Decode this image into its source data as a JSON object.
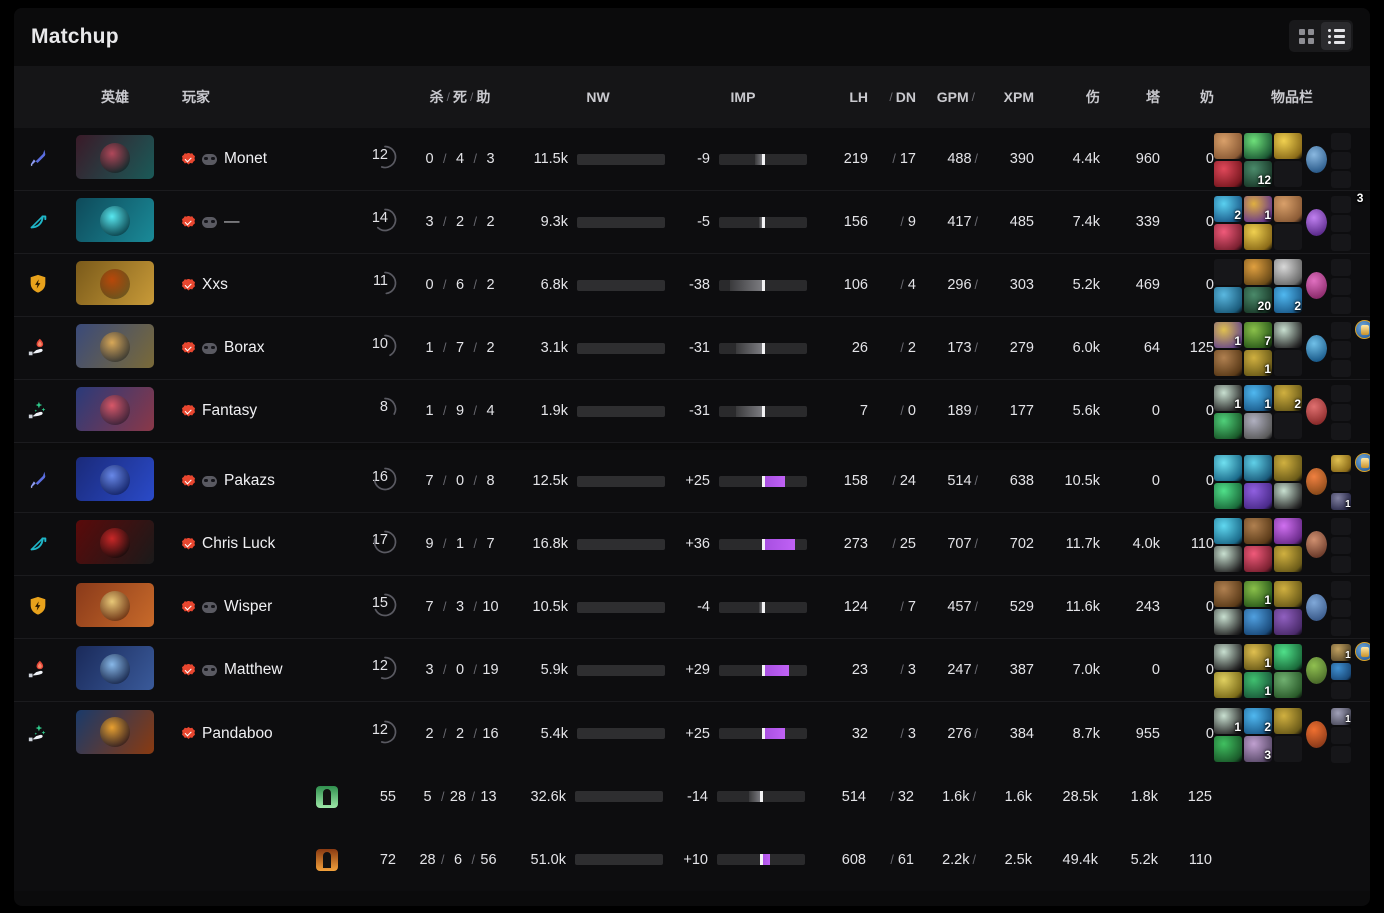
{
  "header": {
    "title": "Matchup",
    "view_grid_label": "grid-view",
    "view_list_label": "list-view",
    "active_view": "list"
  },
  "columns": {
    "hero": "英雄",
    "player": "玩家",
    "kills": "杀",
    "deaths": "死",
    "assists": "助",
    "nw": "NW",
    "imp": "IMP",
    "lh": "LH",
    "dn": "DN",
    "gpm": "GPM",
    "xpm": "XPM",
    "damage": "伤",
    "towers": "塔",
    "healing": "奶",
    "items": "物品栏",
    "slash": "/"
  },
  "colors": {
    "gold": "#e9c04a",
    "purple": "#b95ef0",
    "verified": "#e8462f",
    "radiant": "#5ec07a",
    "dire": "#f2a13c"
  },
  "rows": [
    {
      "role": "carry",
      "verified": true,
      "team_badge": true,
      "player": "Monet",
      "level": "12",
      "level_pct": 55,
      "kills": "0",
      "deaths": "4",
      "assists": "3",
      "nw": "11.5k",
      "nw_pct": 68,
      "imp": "-9",
      "imp_value": -9,
      "lh": "219",
      "dn": "17",
      "gpm": "488",
      "xpm": "390",
      "damage": "4.4k",
      "towers": "960",
      "healing": "0",
      "items": [
        {
          "qty": "",
          "c1": "#8a5a35",
          "c2": "#d9a06a"
        },
        {
          "qty": "",
          "c1": "#1d5a35",
          "c2": "#6ee07a"
        },
        {
          "qty": "",
          "c1": "#8a6a18",
          "c2": "#f0d050"
        },
        {
          "qty": "",
          "c1": "#7a1820",
          "c2": "#e0485a"
        },
        {
          "qty": "12",
          "c1": "#1a3a2a",
          "c2": "#4a8a6a"
        },
        {
          "qty": "",
          "c1": "",
          "c2": ""
        }
      ],
      "neutral": {
        "c1": "#2a5a8a",
        "c2": "#8ab8e0"
      },
      "backpack": [
        {
          "qty": "",
          "c1": "",
          "c2": ""
        },
        {
          "qty": "",
          "c1": "",
          "c2": ""
        },
        {
          "qty": "",
          "c1": "",
          "c2": ""
        }
      ],
      "shard": false,
      "shard_label": ""
    },
    {
      "role": "mid",
      "verified": true,
      "team_badge": true,
      "player": "—",
      "level": "14",
      "level_pct": 62,
      "kills": "3",
      "deaths": "2",
      "assists": "2",
      "nw": "9.3k",
      "nw_pct": 55,
      "imp": "-5",
      "imp_value": -5,
      "lh": "156",
      "dn": "9",
      "gpm": "417",
      "xpm": "485",
      "damage": "7.4k",
      "towers": "339",
      "healing": "0",
      "items": [
        {
          "qty": "2",
          "c1": "#1a5a8a",
          "c2": "#5ad0f0"
        },
        {
          "qty": "1",
          "c1": "#6a3a8a",
          "c2": "#e0b040"
        },
        {
          "qty": "",
          "c1": "#8a5a35",
          "c2": "#d9a06a"
        },
        {
          "qty": "",
          "c1": "#7a2030",
          "c2": "#f05a7a"
        },
        {
          "qty": "",
          "c1": "#8a6a18",
          "c2": "#f0d050"
        },
        {
          "qty": "",
          "c1": "",
          "c2": ""
        }
      ],
      "neutral": {
        "c1": "#5a2a8a",
        "c2": "#c080f0"
      },
      "backpack": [
        {
          "qty": "",
          "c1": "",
          "c2": ""
        },
        {
          "qty": "",
          "c1": "",
          "c2": ""
        },
        {
          "qty": "",
          "c1": "",
          "c2": ""
        }
      ],
      "shard": false,
      "shard_label": "3"
    },
    {
      "role": "offlane",
      "verified": true,
      "team_badge": false,
      "player": "Xxs",
      "level": "11",
      "level_pct": 48,
      "kills": "0",
      "deaths": "6",
      "assists": "2",
      "nw": "6.8k",
      "nw_pct": 40,
      "imp": "-38",
      "imp_value": -38,
      "lh": "106",
      "dn": "4",
      "gpm": "296",
      "xpm": "303",
      "damage": "5.2k",
      "towers": "469",
      "healing": "0",
      "items": [
        {
          "qty": "",
          "c1": "",
          "c2": ""
        },
        {
          "qty": "",
          "c1": "#6a4a18",
          "c2": "#e0a040"
        },
        {
          "qty": "",
          "c1": "#6a6a6a",
          "c2": "#d8d8d8"
        },
        {
          "qty": "",
          "c1": "#1a5a7a",
          "c2": "#5ab8e0"
        },
        {
          "qty": "20",
          "c1": "#1a3a2a",
          "c2": "#4a8a6a"
        },
        {
          "qty": "2",
          "c1": "#1a5a8a",
          "c2": "#50b8f0"
        }
      ],
      "neutral": {
        "c1": "#8a2a6a",
        "c2": "#e070c0"
      },
      "backpack": [
        {
          "qty": "",
          "c1": "",
          "c2": ""
        },
        {
          "qty": "",
          "c1": "",
          "c2": ""
        },
        {
          "qty": "",
          "c1": "",
          "c2": ""
        }
      ],
      "shard": false,
      "shard_label": ""
    },
    {
      "role": "soft-support",
      "verified": true,
      "team_badge": true,
      "player": "Borax",
      "level": "10",
      "level_pct": 42,
      "kills": "1",
      "deaths": "7",
      "assists": "2",
      "nw": "3.1k",
      "nw_pct": 18,
      "imp": "-31",
      "imp_value": -31,
      "lh": "26",
      "dn": "2",
      "gpm": "173",
      "xpm": "279",
      "damage": "6.0k",
      "towers": "64",
      "healing": "125",
      "items": [
        {
          "qty": "1",
          "c1": "#6a4a8a",
          "c2": "#e0c050"
        },
        {
          "qty": "7",
          "c1": "#2a5a1a",
          "c2": "#8ac04a"
        },
        {
          "qty": "",
          "c1": "#2a2a2a",
          "c2": "#c8e0d0"
        },
        {
          "qty": "",
          "c1": "#5a3a18",
          "c2": "#b08050"
        },
        {
          "qty": "1",
          "c1": "#6a5a18",
          "c2": "#d0b040"
        },
        {
          "qty": "",
          "c1": "",
          "c2": ""
        }
      ],
      "neutral": {
        "c1": "#1a5a8a",
        "c2": "#70c0e8"
      },
      "backpack": [
        {
          "qty": "",
          "c1": "",
          "c2": ""
        },
        {
          "qty": "",
          "c1": "",
          "c2": ""
        },
        {
          "qty": "",
          "c1": "",
          "c2": ""
        }
      ],
      "shard": true,
      "shard_label": ""
    },
    {
      "role": "hard-support",
      "verified": true,
      "team_badge": false,
      "player": "Fantasy",
      "level": "8",
      "level_pct": 33,
      "kills": "1",
      "deaths": "9",
      "assists": "4",
      "nw": "1.9k",
      "nw_pct": 11,
      "imp": "-31",
      "imp_value": -31,
      "lh": "7",
      "dn": "0",
      "gpm": "189",
      "xpm": "177",
      "damage": "5.6k",
      "towers": "0",
      "healing": "0",
      "items": [
        {
          "qty": "1",
          "c1": "#2a2a2a",
          "c2": "#c8e0d0"
        },
        {
          "qty": "1",
          "c1": "#1a5a8a",
          "c2": "#50b8f0"
        },
        {
          "qty": "2",
          "c1": "#6a5a18",
          "c2": "#d0b040"
        },
        {
          "qty": "",
          "c1": "#1a5a2a",
          "c2": "#50d07a"
        },
        {
          "qty": "",
          "c1": "#5a5a5a",
          "c2": "#b0b0c0"
        },
        {
          "qty": "",
          "c1": "",
          "c2": ""
        }
      ],
      "neutral": {
        "c1": "#8a2a2a",
        "c2": "#e07070"
      },
      "backpack": [
        {
          "qty": "",
          "c1": "",
          "c2": ""
        },
        {
          "qty": "",
          "c1": "",
          "c2": ""
        },
        {
          "qty": "",
          "c1": "",
          "c2": ""
        }
      ],
      "shard": false,
      "shard_label": ""
    },
    {
      "role": "carry",
      "verified": true,
      "team_badge": true,
      "player": "Pakazs",
      "level": "16",
      "level_pct": 72,
      "kills": "7",
      "deaths": "0",
      "assists": "8",
      "nw": "12.5k",
      "nw_pct": 74,
      "imp": "+25",
      "imp_value": 25,
      "lh": "158",
      "dn": "24",
      "gpm": "514",
      "xpm": "638",
      "damage": "10.5k",
      "towers": "0",
      "healing": "0",
      "items": [
        {
          "qty": "",
          "c1": "#1a6a8a",
          "c2": "#70e0f0"
        },
        {
          "qty": "",
          "c1": "#1a5a7a",
          "c2": "#60d0e8"
        },
        {
          "qty": "",
          "c1": "#6a5a18",
          "c2": "#d0b040"
        },
        {
          "qty": "",
          "c1": "#1a6a3a",
          "c2": "#50e08a"
        },
        {
          "qty": "",
          "c1": "#4a2a8a",
          "c2": "#9060e0"
        },
        {
          "qty": "",
          "c1": "#2a2a2a",
          "c2": "#c8e0d0"
        }
      ],
      "neutral": {
        "c1": "#8a4a1a",
        "c2": "#f08040"
      },
      "backpack": [
        {
          "qty": "",
          "c1": "#8a6a18",
          "c2": "#e0c050"
        },
        {
          "qty": "",
          "c1": "",
          "c2": ""
        },
        {
          "qty": "1",
          "c1": "#2a2a4a",
          "c2": "#8080a0"
        }
      ],
      "shard": true,
      "shard_label": ""
    },
    {
      "role": "mid",
      "verified": true,
      "team_badge": false,
      "player": "Chris Luck",
      "level": "17",
      "level_pct": 80,
      "kills": "9",
      "deaths": "1",
      "assists": "7",
      "nw": "16.8k",
      "nw_pct": 100,
      "imp": "+36",
      "imp_value": 36,
      "lh": "273",
      "dn": "25",
      "gpm": "707",
      "xpm": "702",
      "damage": "11.7k",
      "towers": "4.0k",
      "healing": "110",
      "items": [
        {
          "qty": "",
          "c1": "#1a6a8a",
          "c2": "#60d8f0"
        },
        {
          "qty": "",
          "c1": "#5a3a18",
          "c2": "#b08050"
        },
        {
          "qty": "",
          "c1": "#6a2a8a",
          "c2": "#d070f0"
        },
        {
          "qty": "",
          "c1": "#2a2a2a",
          "c2": "#c8e0d0"
        },
        {
          "qty": "",
          "c1": "#7a2030",
          "c2": "#f05a7a"
        },
        {
          "qty": "",
          "c1": "#6a5a18",
          "c2": "#d0b040"
        }
      ],
      "neutral": {
        "c1": "#6a3a2a",
        "c2": "#d09070"
      },
      "backpack": [
        {
          "qty": "",
          "c1": "",
          "c2": ""
        },
        {
          "qty": "",
          "c1": "",
          "c2": ""
        },
        {
          "qty": "",
          "c1": "",
          "c2": ""
        }
      ],
      "shard": false,
      "shard_label": ""
    },
    {
      "role": "offlane",
      "verified": true,
      "team_badge": true,
      "player": "Wisper",
      "level": "15",
      "level_pct": 68,
      "kills": "7",
      "deaths": "3",
      "assists": "10",
      "nw": "10.5k",
      "nw_pct": 62,
      "imp": "-4",
      "imp_value": -4,
      "lh": "124",
      "dn": "7",
      "gpm": "457",
      "xpm": "529",
      "damage": "11.6k",
      "towers": "243",
      "healing": "0",
      "items": [
        {
          "qty": "",
          "c1": "#5a3a18",
          "c2": "#b08050"
        },
        {
          "qty": "1",
          "c1": "#2a5a1a",
          "c2": "#8ac04a"
        },
        {
          "qty": "",
          "c1": "#6a5a18",
          "c2": "#d0b040"
        },
        {
          "qty": "",
          "c1": "#2a2a2a",
          "c2": "#c8e0d0"
        },
        {
          "qty": "",
          "c1": "#1a4a7a",
          "c2": "#50a0e0"
        },
        {
          "qty": "",
          "c1": "#4a2a6a",
          "c2": "#9060c0"
        }
      ],
      "neutral": {
        "c1": "#3a5a8a",
        "c2": "#80a8d8"
      },
      "backpack": [
        {
          "qty": "",
          "c1": "",
          "c2": ""
        },
        {
          "qty": "",
          "c1": "",
          "c2": ""
        },
        {
          "qty": "",
          "c1": "",
          "c2": ""
        }
      ],
      "shard": false,
      "shard_label": ""
    },
    {
      "role": "soft-support",
      "verified": true,
      "team_badge": true,
      "player": "Matthew",
      "level": "12",
      "level_pct": 55,
      "kills": "3",
      "deaths": "0",
      "assists": "19",
      "nw": "5.9k",
      "nw_pct": 35,
      "imp": "+29",
      "imp_value": 29,
      "lh": "23",
      "dn": "3",
      "gpm": "247",
      "xpm": "387",
      "damage": "7.0k",
      "towers": "0",
      "healing": "0",
      "items": [
        {
          "qty": "",
          "c1": "#2a2a2a",
          "c2": "#c8e0d0"
        },
        {
          "qty": "1",
          "c1": "#6a5a18",
          "c2": "#e0c050"
        },
        {
          "qty": "",
          "c1": "#1a6a3a",
          "c2": "#50e08a"
        },
        {
          "qty": "",
          "c1": "#7a6a18",
          "c2": "#e0d060"
        },
        {
          "qty": "1",
          "c1": "#1a5a3a",
          "c2": "#40c070"
        },
        {
          "qty": "",
          "c1": "#2a5a2a",
          "c2": "#70b070"
        }
      ],
      "neutral": {
        "c1": "#4a6a2a",
        "c2": "#90c050"
      },
      "backpack": [
        {
          "qty": "1",
          "c1": "#5a4a2a",
          "c2": "#c0a060"
        },
        {
          "qty": "",
          "c1": "#1a4a7a",
          "c2": "#4090d0"
        },
        {
          "qty": "",
          "c1": "",
          "c2": ""
        }
      ],
      "shard": true,
      "shard_label": ""
    },
    {
      "role": "hard-support",
      "verified": true,
      "team_badge": false,
      "player": "Pandaboo",
      "level": "12",
      "level_pct": 55,
      "kills": "2",
      "deaths": "2",
      "assists": "16",
      "nw": "5.4k",
      "nw_pct": 32,
      "imp": "+25",
      "imp_value": 25,
      "lh": "32",
      "dn": "3",
      "gpm": "276",
      "xpm": "384",
      "damage": "8.7k",
      "towers": "955",
      "healing": "0",
      "items": [
        {
          "qty": "1",
          "c1": "#2a2a2a",
          "c2": "#c8e0d0"
        },
        {
          "qty": "2",
          "c1": "#1a5a8a",
          "c2": "#50b8f0"
        },
        {
          "qty": "",
          "c1": "#6a5a18",
          "c2": "#d0b040"
        },
        {
          "qty": "",
          "c1": "#1a5a2a",
          "c2": "#40c060"
        },
        {
          "qty": "3",
          "c1": "#5a4a6a",
          "c2": "#c0a0d0"
        },
        {
          "qty": "",
          "c1": "",
          "c2": ""
        }
      ],
      "neutral": {
        "c1": "#8a3a1a",
        "c2": "#f07030"
      },
      "backpack": [
        {
          "qty": "1",
          "c1": "#4a4a5a",
          "c2": "#a0a0b8"
        },
        {
          "qty": "",
          "c1": "",
          "c2": ""
        },
        {
          "qty": "",
          "c1": "",
          "c2": ""
        }
      ],
      "shard": false,
      "shard_label": ""
    }
  ],
  "summary": [
    {
      "team": "radiant",
      "level": "55",
      "kills": "5",
      "deaths": "28",
      "assists": "13",
      "nw": "32.6k",
      "nw_pct": 64,
      "imp": "-14",
      "imp_value": -14,
      "lh": "514",
      "dn": "32",
      "gpm": "1.6k",
      "xpm": "1.6k",
      "damage": "28.5k",
      "towers": "1.8k",
      "healing": "125"
    },
    {
      "team": "dire",
      "level": "72",
      "kills": "28",
      "deaths": "6",
      "assists": "56",
      "nw": "51.0k",
      "nw_pct": 100,
      "imp": "+10",
      "imp_value": 10,
      "lh": "608",
      "dn": "61",
      "gpm": "2.2k",
      "xpm": "2.5k",
      "damage": "49.4k",
      "towers": "5.2k",
      "healing": "110"
    }
  ],
  "hero_art": [
    {
      "bg1": "#3a1a28",
      "bg2": "#1a5a58",
      "face": "#b0485a"
    },
    {
      "bg1": "#0e4a5a",
      "bg2": "#1a8a98",
      "face": "#58e8f0"
    },
    {
      "bg1": "#7a5a1a",
      "bg2": "#c89a38",
      "face": "#b8480a"
    },
    {
      "bg1": "#3a4a7a",
      "bg2": "#7a6a38",
      "face": "#d8a858"
    },
    {
      "bg1": "#2a3a7a",
      "bg2": "#8a3848",
      "face": "#d85868"
    },
    {
      "bg1": "#1a2a7a",
      "bg2": "#2a4ac8",
      "face": "#6888e8"
    },
    {
      "bg1": "#5a0a0a",
      "bg2": "#1a1a1a",
      "face": "#c82828"
    },
    {
      "bg1": "#8a3a1a",
      "bg2": "#c86a2a",
      "face": "#e8c878"
    },
    {
      "bg1": "#1a2a5a",
      "bg2": "#3a5a9a",
      "face": "#88b8e8"
    },
    {
      "bg1": "#1a3a6a",
      "bg2": "#8a3a10",
      "face": "#e8a030"
    }
  ]
}
